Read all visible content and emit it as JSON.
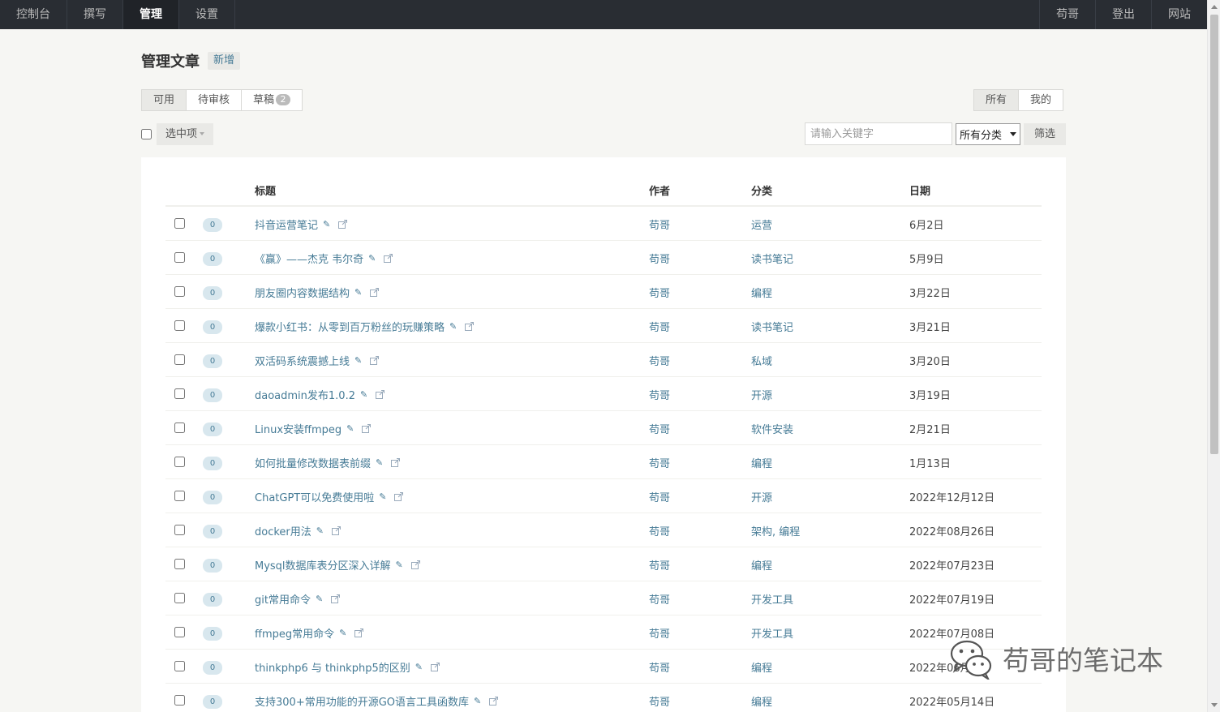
{
  "nav": {
    "left": [
      "控制台",
      "撰写",
      "管理",
      "设置"
    ],
    "active": "管理",
    "right": [
      "苟哥",
      "登出",
      "网站"
    ]
  },
  "header": {
    "title": "管理文章",
    "new_label": "新增"
  },
  "status_tabs": [
    {
      "label": "可用",
      "badge": ""
    },
    {
      "label": "待审核",
      "badge": ""
    },
    {
      "label": "草稿",
      "badge": "2"
    }
  ],
  "scope_tabs": [
    "所有",
    "我的"
  ],
  "operate": {
    "select_label": "选中项"
  },
  "search": {
    "placeholder": "请输入关键字",
    "category_selected": "所有分类",
    "filter_label": "筛选"
  },
  "table": {
    "columns": {
      "title": "标题",
      "author": "作者",
      "category": "分类",
      "date": "日期"
    },
    "rows": [
      {
        "comments": "0",
        "title": "抖音运营笔记",
        "author": "苟哥",
        "category": "运营",
        "date": "6月2日"
      },
      {
        "comments": "0",
        "title": "《赢》——杰克 韦尔奇",
        "author": "苟哥",
        "category": "读书笔记",
        "date": "5月9日"
      },
      {
        "comments": "0",
        "title": "朋友圈内容数据结构",
        "author": "苟哥",
        "category": "编程",
        "date": "3月22日"
      },
      {
        "comments": "0",
        "title": "爆款小红书：从零到百万粉丝的玩赚策略",
        "author": "苟哥",
        "category": "读书笔记",
        "date": "3月21日"
      },
      {
        "comments": "0",
        "title": "双活码系统震撼上线",
        "author": "苟哥",
        "category": "私域",
        "date": "3月20日"
      },
      {
        "comments": "0",
        "title": "daoadmin发布1.0.2",
        "author": "苟哥",
        "category": "开源",
        "date": "3月19日"
      },
      {
        "comments": "0",
        "title": "Linux安装ffmpeg",
        "author": "苟哥",
        "category": "软件安装",
        "date": "2月21日"
      },
      {
        "comments": "0",
        "title": "如何批量修改数据表前缀",
        "author": "苟哥",
        "category": "编程",
        "date": "1月13日"
      },
      {
        "comments": "0",
        "title": "ChatGPT可以免费使用啦",
        "author": "苟哥",
        "category": "开源",
        "date": "2022年12月12日"
      },
      {
        "comments": "0",
        "title": "docker用法",
        "author": "苟哥",
        "category": "架构, 编程",
        "date": "2022年08月26日"
      },
      {
        "comments": "0",
        "title": "Mysql数据库表分区深入详解",
        "author": "苟哥",
        "category": "编程",
        "date": "2022年07月23日"
      },
      {
        "comments": "0",
        "title": "git常用命令",
        "author": "苟哥",
        "category": "开发工具",
        "date": "2022年07月19日"
      },
      {
        "comments": "0",
        "title": "ffmpeg常用命令",
        "author": "苟哥",
        "category": "开发工具",
        "date": "2022年07月08日"
      },
      {
        "comments": "0",
        "title": "thinkphp6 与 thinkphp5的区别",
        "author": "苟哥",
        "category": "编程",
        "date": "2022年06月"
      },
      {
        "comments": "0",
        "title": "支持300+常用功能的开源GO语言工具函数库",
        "author": "苟哥",
        "category": "编程",
        "date": "2022年05月14日"
      }
    ]
  },
  "watermark": {
    "text": "苟哥的笔记本"
  },
  "colors": {
    "nav_bg": "#292d33",
    "link": "#467b96",
    "page_bg": "#f6f6f3"
  }
}
